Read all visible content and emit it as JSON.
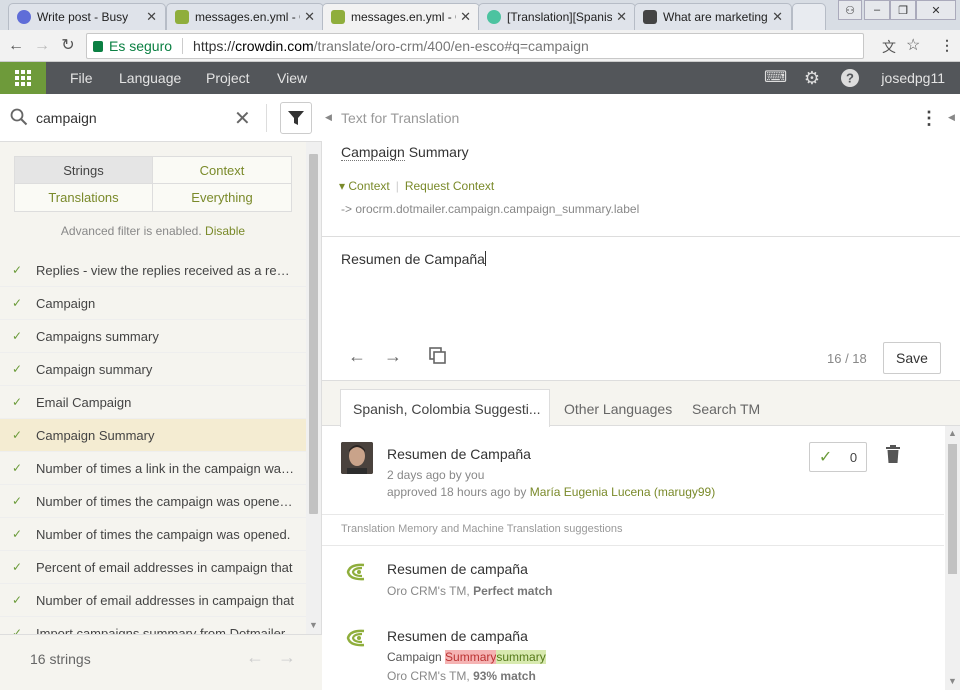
{
  "browser": {
    "tabs": [
      {
        "title": "Write post - Busy",
        "color": "#5f6dd8"
      },
      {
        "title": "messages.en.yml - C",
        "color": "#8fae3c"
      },
      {
        "title": "messages.en.yml - C",
        "color": "#8fae3c"
      },
      {
        "title": "[Translation][Spanis",
        "color": "#4cc3a0"
      },
      {
        "title": "What are marketing",
        "color": "#444444"
      }
    ],
    "secure_label": "Es seguro",
    "url_scheme": "https://",
    "url_host": "crowdin.com",
    "url_path": "/translate/oro-crm/400/en-esco#q=campaign"
  },
  "menubar": {
    "items": [
      "File",
      "Language",
      "Project",
      "View"
    ],
    "user": "josedpg11"
  },
  "search": {
    "value": "campaign"
  },
  "filters": {
    "strings": "Strings",
    "context": "Context",
    "translations": "Translations",
    "everything": "Everything",
    "advanced_note": "Advanced filter is enabled.",
    "disable": "Disable"
  },
  "strings_list": [
    "Replies - view the replies received as a result of the",
    "Campaign",
    "Campaigns summary",
    "Campaign summary",
    "Email Campaign",
    "Campaign Summary",
    "Number of times a link in the campaign was clicked",
    "Number of times the campaign was opened by",
    "Number of times the campaign was opened.",
    "Percent of email addresses in campaign that",
    "Number of email addresses in campaign that",
    "Import campaigns summary from Dotmailer"
  ],
  "strings_count": "16 strings",
  "source": {
    "header": "Text for Translation",
    "text_a": "Campaign",
    "text_b": " Summary",
    "context_label": "Context",
    "request_context": "Request Context",
    "context_path": "-> orocrm.dotmailer.campaign.campaign_summary.label"
  },
  "editor": {
    "value": "Resumen de Campaña",
    "counter": "16 / 18",
    "save": "Save"
  },
  "suggestion_tabs": [
    "Spanish, Colombia Suggesti...",
    "Other Languages",
    "Search TM"
  ],
  "suggestion": {
    "text": "Resumen de Campaña",
    "time": "2 days ago by you",
    "approved_prefix": "approved 18 hours ago by ",
    "approver": "María Eugenia Lucena (marugy99)",
    "votes": "0"
  },
  "tm_header": "Translation Memory and Machine Translation suggestions",
  "tm": [
    {
      "text": "Resumen de campaña",
      "source": "Oro CRM's TM, ",
      "match": "Perfect match"
    },
    {
      "text": "Resumen de campaña",
      "diff_plain": "Campaign ",
      "diff_del": "Summary",
      "diff_ins": "summary",
      "source": "Oro CRM's TM, ",
      "match": "93% match"
    }
  ],
  "colors": {
    "brand_green": "#6e9a3a",
    "menubar": "#53565a",
    "link_olive": "#7a8a2a"
  }
}
